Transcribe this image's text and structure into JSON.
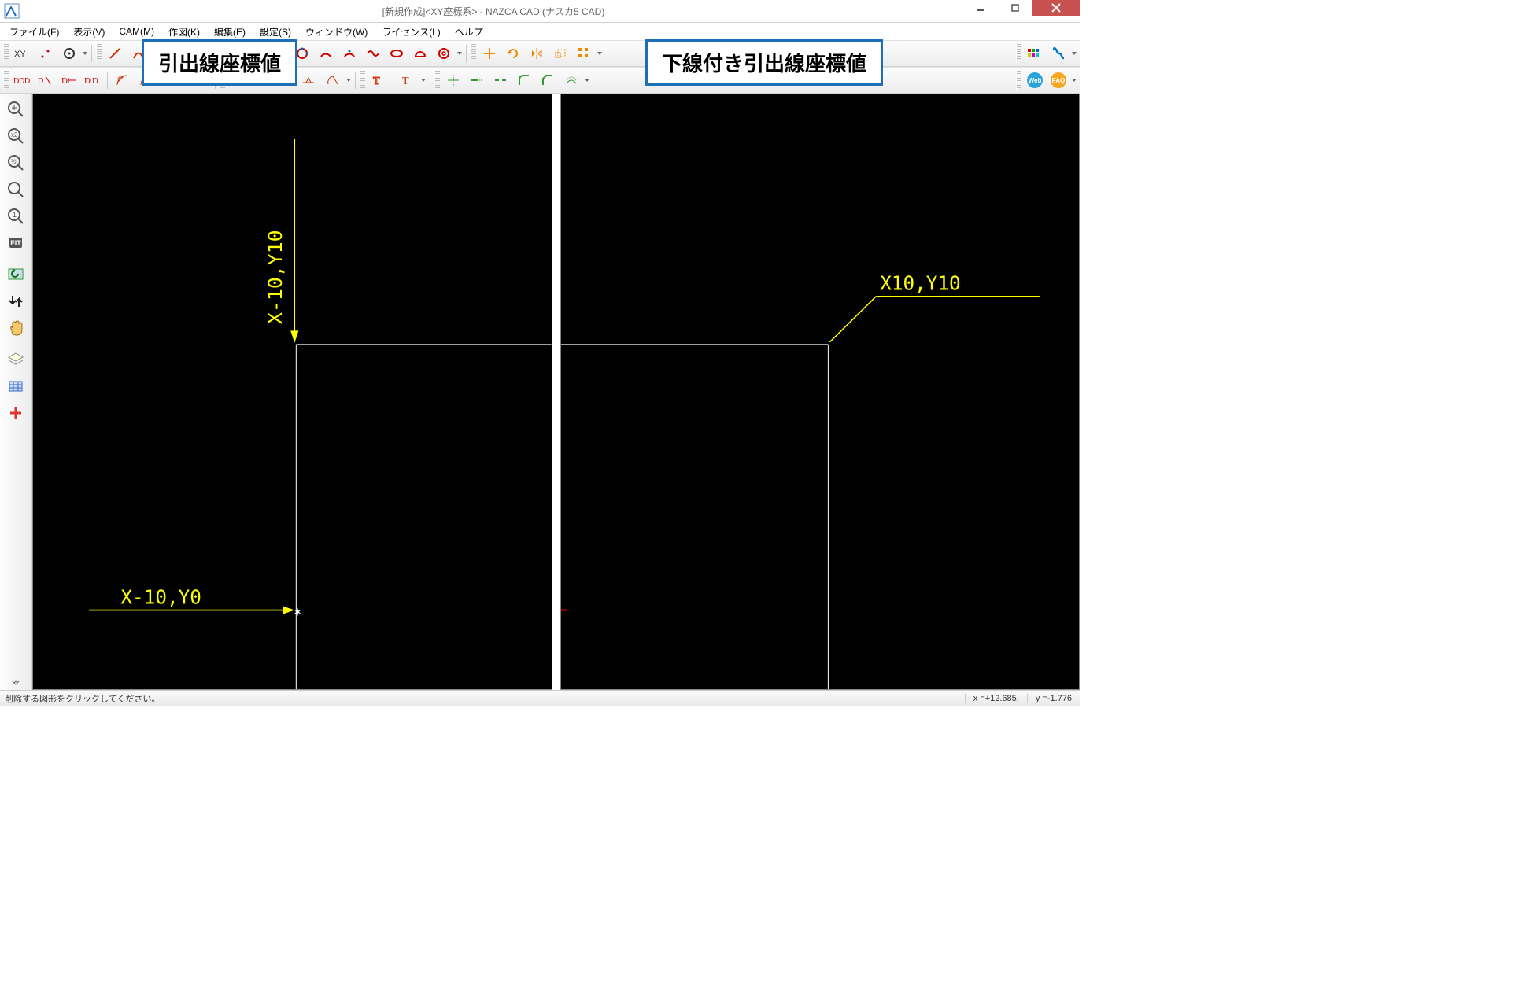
{
  "window": {
    "title": "[新規作成]<XY座標系> - NAZCA CAD (ナスカ5 CAD)"
  },
  "menu": {
    "file": "ファイル(F)",
    "view": "表示(V)",
    "cam": "CAM(M)",
    "draw": "作図(K)",
    "edit": "編集(E)",
    "set": "設定(S)",
    "window": "ウィンドウ(W)",
    "license": "ライセンス(L)",
    "help": "ヘルプ"
  },
  "callouts": {
    "left": "引出線座標値",
    "right": "下線付き引出線座標値"
  },
  "canvas": {
    "left": {
      "label_top": "X-10,Y10",
      "label_bottom": "X-10,Y0"
    },
    "right": {
      "label_top": "X10,Y10"
    }
  },
  "status": {
    "message": "削除する図形をクリックしてください。",
    "x": "x =+12.685,",
    "y": "y =-1.776"
  },
  "icons": {
    "zoom_in": "zoom-in",
    "zoom_x2": "zoom-x2",
    "zoom_half": "zoom-half",
    "zoom": "zoom",
    "zoom_1": "zoom-1",
    "fit": "fit",
    "redo": "redo",
    "flip": "flip",
    "hand": "hand",
    "layers": "layers",
    "grid": "grid",
    "plus": "plus"
  }
}
